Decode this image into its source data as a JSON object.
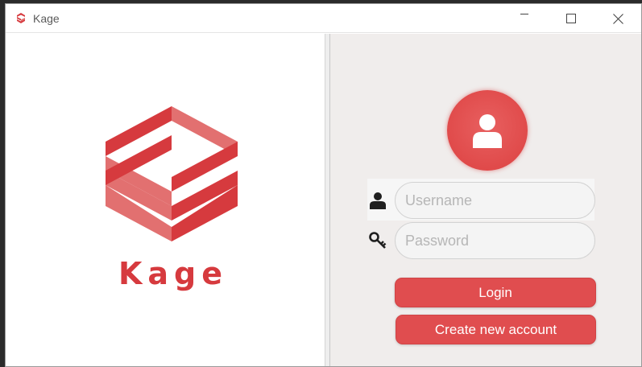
{
  "window": {
    "title": "Kage",
    "icon": "kage-logo-icon",
    "controls": [
      "minimize-icon",
      "maximize-icon",
      "close-icon"
    ]
  },
  "brand": {
    "name": "Kage",
    "color": "#d63a3e"
  },
  "login": {
    "avatar_icon": "user-avatar-icon",
    "username": {
      "icon": "user-icon",
      "placeholder": "Username",
      "value": ""
    },
    "password": {
      "icon": "key-icon",
      "placeholder": "Password",
      "value": ""
    },
    "login_label": "Login",
    "create_label": "Create new account",
    "accent": "#e04d4f"
  }
}
